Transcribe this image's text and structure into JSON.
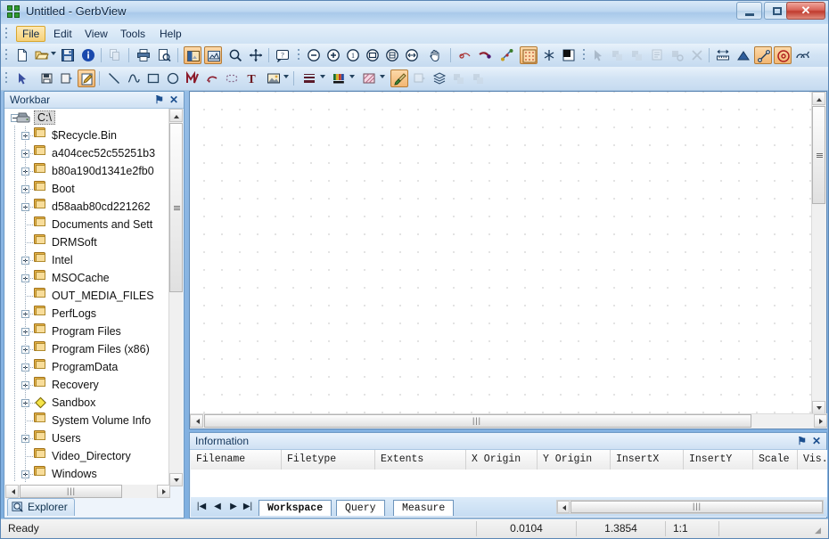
{
  "window": {
    "title": "Untitled - GerbView",
    "logo_icon": "gerbview-logo-icon",
    "minimize_label": "Minimize",
    "maximize_label": "Maximize",
    "close_label": "✕"
  },
  "menubar": {
    "items": [
      {
        "label": "File",
        "active": true
      },
      {
        "label": "Edit",
        "active": false
      },
      {
        "label": "View",
        "active": false
      },
      {
        "label": "Tools",
        "active": false
      },
      {
        "label": "Help",
        "active": false
      }
    ]
  },
  "toolbar_top": {
    "items": [
      {
        "name": "new-icon",
        "glyph": "὜B"
      },
      {
        "name": "open-icon",
        "glyph": "open"
      },
      {
        "name": "open-dropdown-caret-icon",
        "glyph": "caret"
      },
      {
        "name": "save-icon",
        "glyph": "save"
      },
      {
        "name": "info-icon",
        "glyph": "i"
      },
      {
        "name": "copy-icon",
        "glyph": "copy",
        "disabled": true
      },
      {
        "name": "print-icon",
        "glyph": "print"
      },
      {
        "name": "print-preview-icon",
        "glyph": "preview"
      },
      {
        "name": "layers-view-icon",
        "glyph": "layers",
        "active": true
      },
      {
        "name": "negative-view-icon",
        "glyph": "negative",
        "active": true
      },
      {
        "name": "zoom-icon",
        "glyph": "magnifier"
      },
      {
        "name": "pan-crosshair-icon",
        "glyph": "crosshair"
      },
      {
        "name": "help-icon",
        "glyph": "?"
      },
      {
        "name": "zoom-out-icon",
        "glyph": "zoom-minus"
      },
      {
        "name": "zoom-in-icon",
        "glyph": "zoom-plus"
      },
      {
        "name": "zoom-one-to-one-icon",
        "glyph": "zoom-1"
      },
      {
        "name": "zoom-window-icon",
        "glyph": "zoom-window"
      },
      {
        "name": "zoom-last-icon",
        "glyph": "zoom-last"
      },
      {
        "name": "zoom-extents-icon",
        "glyph": "zoom-extents"
      },
      {
        "name": "pan-hand-icon",
        "glyph": "hand"
      },
      {
        "name": "measure-distance-icon",
        "glyph": "measure"
      },
      {
        "name": "measure-angle-icon",
        "glyph": "angle"
      },
      {
        "name": "snap-icon",
        "glyph": "snap"
      },
      {
        "name": "grid-toggle-icon",
        "glyph": "grid",
        "active": true
      },
      {
        "name": "snap-point-icon",
        "glyph": "asterisk"
      },
      {
        "name": "color-invert-icon",
        "glyph": "half-square"
      },
      {
        "name": "select-arrow-icon",
        "glyph": "arrow",
        "disabled": true
      },
      {
        "name": "select-add-icon",
        "glyph": "sel-add",
        "disabled": true
      },
      {
        "name": "select-remove-icon",
        "glyph": "sel-remove",
        "disabled": true
      },
      {
        "name": "properties-icon",
        "glyph": "props",
        "disabled": true
      },
      {
        "name": "delete-object-icon",
        "glyph": "del-obj",
        "disabled": true
      },
      {
        "name": "delete-icon",
        "glyph": "x",
        "disabled": true
      },
      {
        "name": "measure-linear-icon",
        "glyph": "ruler"
      },
      {
        "name": "measure-area-icon",
        "glyph": "area"
      },
      {
        "name": "measure-line-icon",
        "glyph": "line-measure",
        "active": true
      },
      {
        "name": "measure-circle-icon",
        "glyph": "circle-measure",
        "active": true
      },
      {
        "name": "measure-arc-icon",
        "glyph": "arc-measure"
      }
    ]
  },
  "toolbar_bottom": {
    "items": [
      {
        "name": "pointer-icon",
        "glyph": "pointer"
      },
      {
        "name": "insert-image-icon",
        "glyph": "stamp1"
      },
      {
        "name": "insert-shape-icon",
        "glyph": "stamp2"
      },
      {
        "name": "edit-pencil-icon",
        "glyph": "pencil",
        "active": true
      },
      {
        "name": "draw-line-icon",
        "glyph": "line"
      },
      {
        "name": "draw-curve-icon",
        "glyph": "curve"
      },
      {
        "name": "draw-rectangle-icon",
        "glyph": "rect"
      },
      {
        "name": "draw-circle-icon",
        "glyph": "circle"
      },
      {
        "name": "draw-polygon-icon",
        "glyph": "polygon"
      },
      {
        "name": "draw-arc-icon",
        "glyph": "arc"
      },
      {
        "name": "draw-selection-icon",
        "glyph": "dashed-rect"
      },
      {
        "name": "insert-text-icon",
        "glyph": "T"
      },
      {
        "name": "insert-picture-icon",
        "glyph": "picture"
      },
      {
        "name": "insert-picture-caret-icon",
        "glyph": "caret"
      },
      {
        "name": "line-width-icon",
        "glyph": "lines"
      },
      {
        "name": "line-width-caret-icon",
        "glyph": "caret"
      },
      {
        "name": "color-palette-icon",
        "glyph": "palette"
      },
      {
        "name": "color-palette-caret-icon",
        "glyph": "caret"
      },
      {
        "name": "fill-pattern-icon",
        "glyph": "hatch"
      },
      {
        "name": "fill-pattern-caret-icon",
        "glyph": "caret"
      },
      {
        "name": "brush-icon",
        "glyph": "brush",
        "active": true
      },
      {
        "name": "layer-properties-icon",
        "glyph": "layer-props",
        "disabled": true
      },
      {
        "name": "layers-stack-icon",
        "glyph": "layers-stack"
      },
      {
        "name": "layer-up-icon",
        "glyph": "layer-up",
        "disabled": true
      },
      {
        "name": "layer-down-icon",
        "glyph": "layer-down",
        "disabled": true
      }
    ]
  },
  "workbar": {
    "title": "Workbar",
    "pin_icon": "⚑",
    "close_icon": "✕",
    "explorer_tab": "Explorer",
    "explorer_tab_icon": "explorer-icon",
    "tree": [
      {
        "label": "C:\\",
        "depth": 0,
        "expander": "minus",
        "icon": "drive",
        "selected": true
      },
      {
        "label": "$Recycle.Bin",
        "depth": 1,
        "expander": "plus",
        "icon": "folder"
      },
      {
        "label": "a404cec52c55251b3",
        "depth": 1,
        "expander": "plus",
        "icon": "folder"
      },
      {
        "label": "b80a190d1341e2fb0",
        "depth": 1,
        "expander": "plus",
        "icon": "folder"
      },
      {
        "label": "Boot",
        "depth": 1,
        "expander": "plus",
        "icon": "folder"
      },
      {
        "label": "d58aab80cd221262",
        "depth": 1,
        "expander": "plus",
        "icon": "folder"
      },
      {
        "label": "Documents and Sett",
        "depth": 1,
        "expander": "none",
        "icon": "folder"
      },
      {
        "label": "DRMSoft",
        "depth": 1,
        "expander": "none",
        "icon": "folder"
      },
      {
        "label": "Intel",
        "depth": 1,
        "expander": "plus",
        "icon": "folder"
      },
      {
        "label": "MSOCache",
        "depth": 1,
        "expander": "plus",
        "icon": "folder"
      },
      {
        "label": "OUT_MEDIA_FILES",
        "depth": 1,
        "expander": "none",
        "icon": "folder"
      },
      {
        "label": "PerfLogs",
        "depth": 1,
        "expander": "plus",
        "icon": "folder"
      },
      {
        "label": "Program Files",
        "depth": 1,
        "expander": "plus",
        "icon": "folder"
      },
      {
        "label": "Program Files (x86)",
        "depth": 1,
        "expander": "plus",
        "icon": "folder"
      },
      {
        "label": "ProgramData",
        "depth": 1,
        "expander": "plus",
        "icon": "folder"
      },
      {
        "label": "Recovery",
        "depth": 1,
        "expander": "plus",
        "icon": "folder"
      },
      {
        "label": "Sandbox",
        "depth": 1,
        "expander": "plus",
        "icon": "sandbox"
      },
      {
        "label": "System Volume Info",
        "depth": 1,
        "expander": "none",
        "icon": "folder"
      },
      {
        "label": "Users",
        "depth": 1,
        "expander": "plus",
        "icon": "folder"
      },
      {
        "label": "Video_Directory",
        "depth": 1,
        "expander": "none",
        "icon": "folder"
      },
      {
        "label": "Windows",
        "depth": 1,
        "expander": "plus",
        "icon": "folder"
      }
    ]
  },
  "information": {
    "title": "Information",
    "pin_icon": "⚑",
    "close_icon": "✕",
    "columns": [
      {
        "label": "Filename",
        "width": 102
      },
      {
        "label": "Filetype",
        "width": 105
      },
      {
        "label": "Extents",
        "width": 102
      },
      {
        "label": "X Origin",
        "width": 80
      },
      {
        "label": "Y Origin",
        "width": 82
      },
      {
        "label": "InsertX",
        "width": 82
      },
      {
        "label": "InsertY",
        "width": 78
      },
      {
        "label": "Scale",
        "width": 50
      },
      {
        "label": "Vis...",
        "width": 40
      }
    ],
    "rows": [],
    "nav": {
      "first": "⏮",
      "prev": "◀",
      "next": "▶",
      "last": "⏭"
    },
    "tabs": [
      {
        "label": "Workspace",
        "active": true
      },
      {
        "label": "Query",
        "active": false
      },
      {
        "label": "Measure",
        "active": false
      }
    ]
  },
  "statusbar": {
    "message": "Ready",
    "panes": [
      "0.0104",
      "1.3854",
      "1:1"
    ]
  },
  "colors": {
    "accent": "#f2b673",
    "titlebar": "#bcd6f0",
    "panel_border": "#6f9bc6",
    "canvas_bg": "#ffffff",
    "grid_dot": "#8f8f8f",
    "close_button": "#bf3b2e"
  }
}
